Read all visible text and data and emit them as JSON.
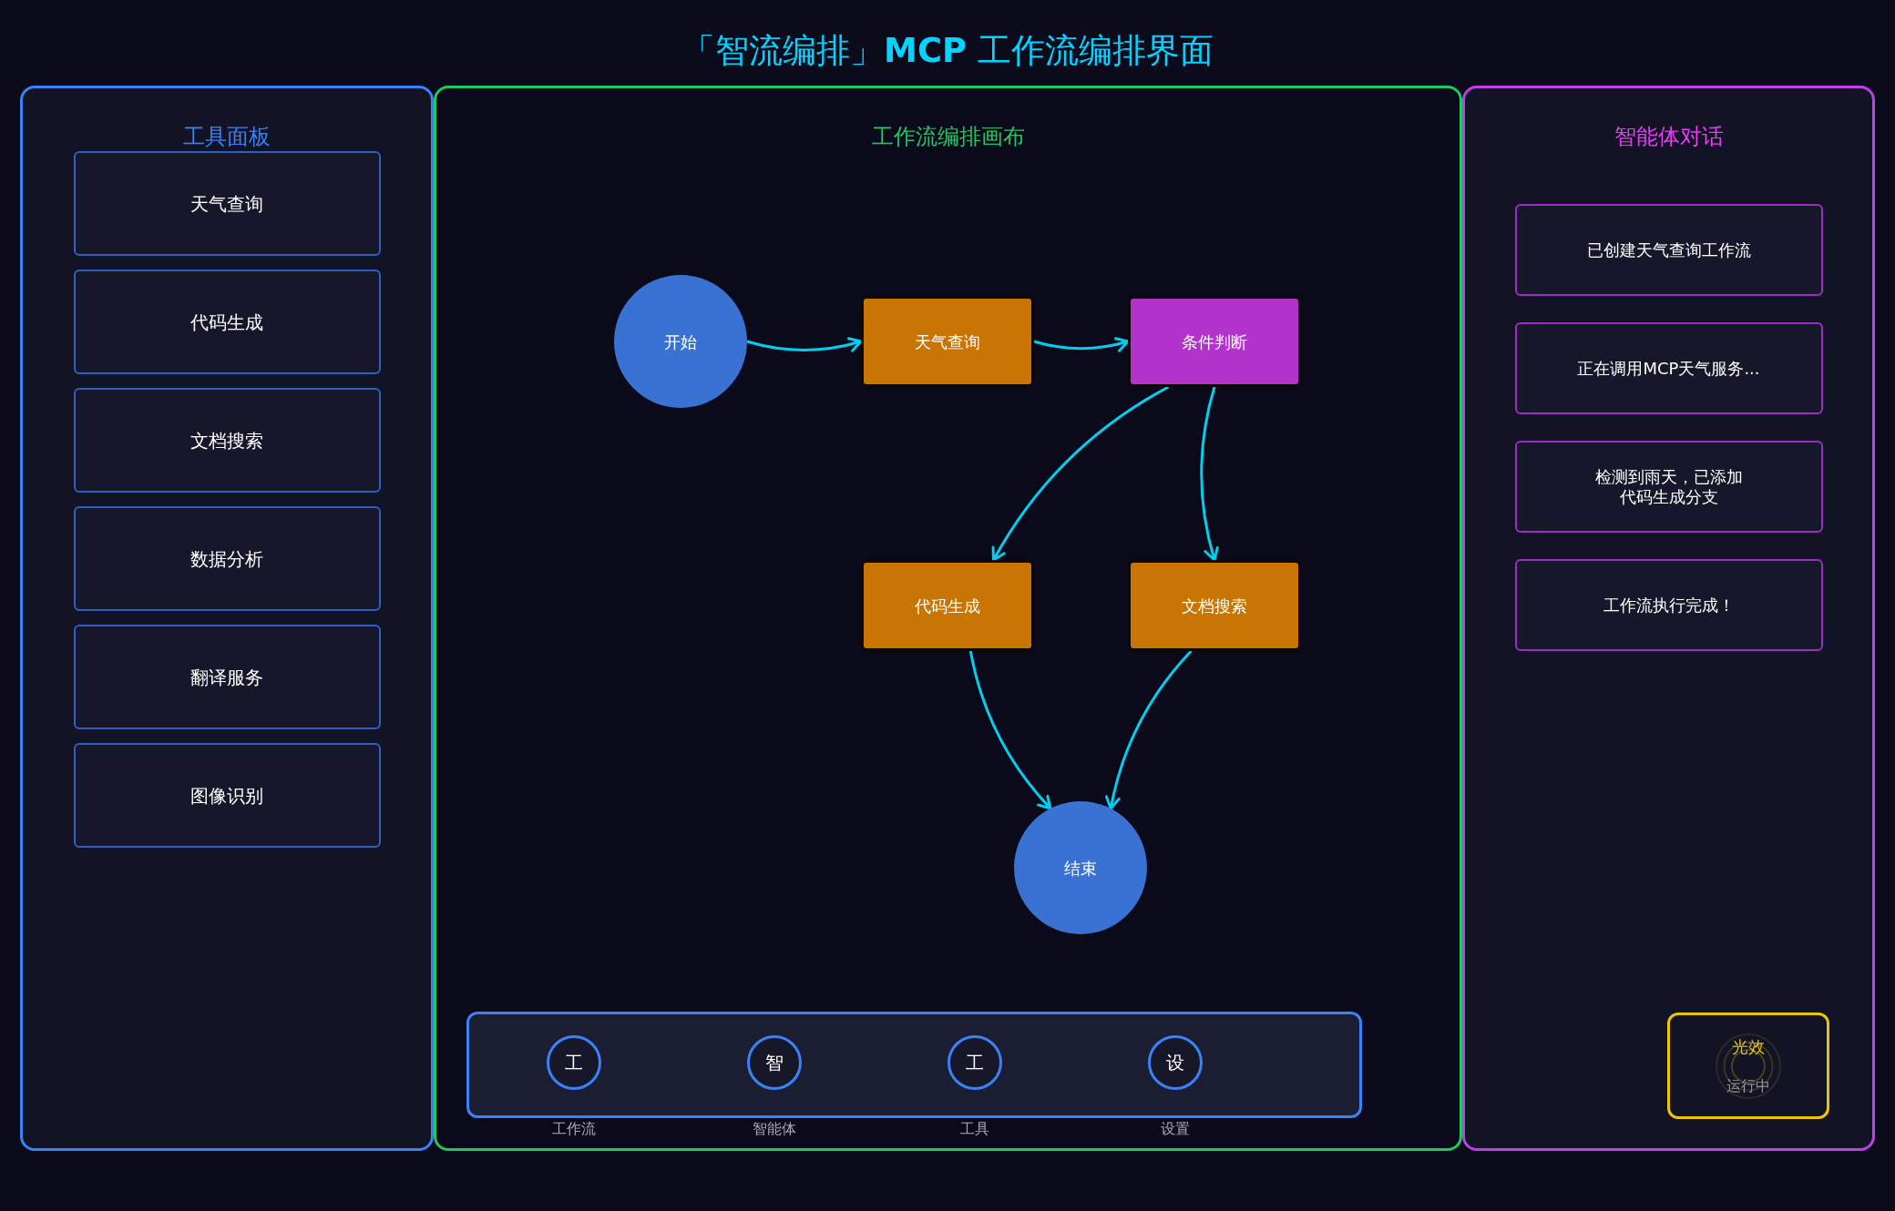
{
  "title": "「智流编排」**MCP** 工作流编排界面",
  "tool_panel": {
    "title": "工具面板",
    "tools": [
      "天气查询",
      "代码生成",
      "文档搜索",
      "数据分析",
      "翻译服务",
      "图像识别"
    ]
  },
  "canvas": {
    "title": "工作流编排画布",
    "nodes": [
      {
        "label": "开始",
        "kind": "start"
      },
      {
        "label": "天气查询",
        "kind": "tool"
      },
      {
        "label": "条件判断",
        "kind": "condition"
      },
      {
        "label": "代码生成",
        "kind": "tool"
      },
      {
        "label": "文档搜索",
        "kind": "tool"
      },
      {
        "label": "结束",
        "kind": "end"
      }
    ]
  },
  "toolbar": {
    "items": [
      {
        "glyph": "工",
        "label": "工作流"
      },
      {
        "glyph": "智",
        "label": "智能体"
      },
      {
        "glyph": "工",
        "label": "工具"
      },
      {
        "glyph": "设",
        "label": "设置"
      }
    ]
  },
  "chat_panel": {
    "title": "智能体对话",
    "messages": [
      {
        "lines": [
          "已创建天气查询工作流"
        ]
      },
      {
        "lines": [
          "正在调用MCP天气服务..."
        ]
      },
      {
        "lines": [
          "检测到雨天，已添加",
          "代码生成分支"
        ]
      },
      {
        "lines": [
          "工作流执行完成！"
        ]
      }
    ]
  },
  "effect_panel": {
    "title": "光效",
    "status": "运行中"
  }
}
